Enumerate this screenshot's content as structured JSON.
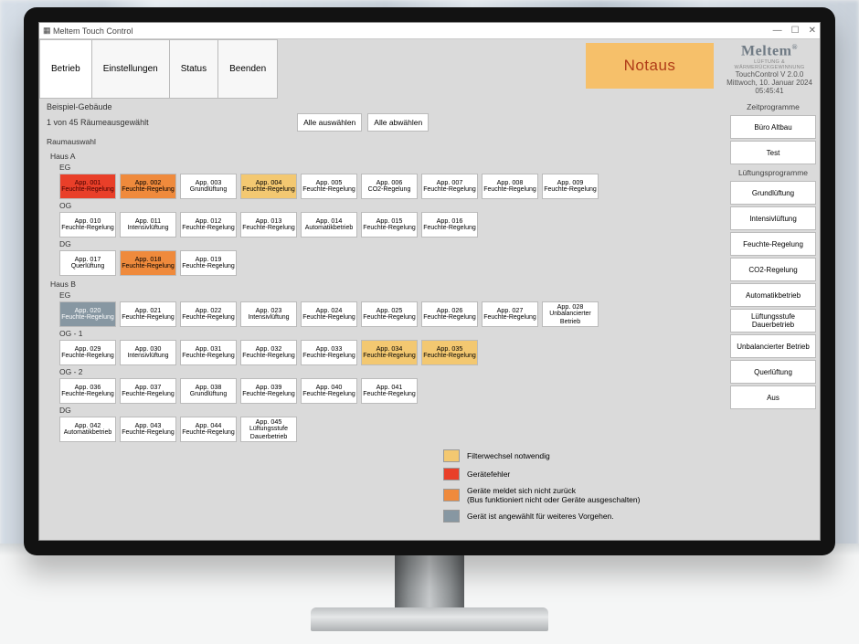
{
  "window": {
    "title": "Meltem Touch Control"
  },
  "menu": {
    "items": [
      "Betrieb",
      "Einstellungen",
      "Status",
      "Beenden"
    ],
    "active": 0
  },
  "brand": {
    "name": "Meltem",
    "sub": "LÜFTUNG & WÄRMERÜCKGEWINNUNG",
    "product": "TouchControl V 2.0.0",
    "datetime": "Mittwoch, 10. Januar 2024 05:45:41"
  },
  "notaus": "Notaus",
  "header": {
    "building": "Beispiel-Gebäude",
    "selection": "1 von 45 Räumeausgewählt",
    "select_all": "Alle auswählen",
    "deselect_all": "Alle abwählen",
    "roomselect": "Raumauswahl"
  },
  "sidebar": {
    "zp_header": "Zeitprogramme",
    "zp_items": [
      "Büro Altbau",
      "Test"
    ],
    "lp_header": "Lüftungsprogramme",
    "lp_items": [
      "Grundlüftung",
      "Intensivlüftung",
      "Feuchte-Regelung",
      "CO2-Regelung",
      "Automatikbetrieb",
      "Lüftungsstufe Dauerbetrieb",
      "Unbalancierter Betrieb",
      "Querlüftung",
      "Aus"
    ]
  },
  "legend": {
    "filter": "Filterwechsel notwendig",
    "error": "Gerätefehler",
    "offline": "Geräte meldet sich nicht zurück\n(Bus funktioniert nicht oder Geräte ausgeschalten)",
    "selected": "Gerät ist angewählt für weiteres Vorgehen."
  },
  "houses": [
    {
      "name": "Haus A",
      "floors": [
        {
          "name": "EG",
          "rooms": [
            {
              "id": "App. 001",
              "mode": "Feuchte-Regelung",
              "status": "error"
            },
            {
              "id": "App. 002",
              "mode": "Feuchte-Regelung",
              "status": "offline"
            },
            {
              "id": "App. 003",
              "mode": "Grundlüftung",
              "status": "ok"
            },
            {
              "id": "App. 004",
              "mode": "Feuchte-Regelung",
              "status": "filter"
            },
            {
              "id": "App. 005",
              "mode": "Feuchte-Regelung",
              "status": "ok"
            },
            {
              "id": "App. 006",
              "mode": "CO2-Regelung",
              "status": "ok"
            },
            {
              "id": "App. 007",
              "mode": "Feuchte-Regelung",
              "status": "ok"
            },
            {
              "id": "App. 008",
              "mode": "Feuchte-Regelung",
              "status": "ok"
            },
            {
              "id": "App. 009",
              "mode": "Feuchte-Regelung",
              "status": "ok"
            }
          ]
        },
        {
          "name": "OG",
          "rooms": [
            {
              "id": "App. 010",
              "mode": "Feuchte-Regelung",
              "status": "ok"
            },
            {
              "id": "App. 011",
              "mode": "Intensivlüftung",
              "status": "ok"
            },
            {
              "id": "App. 012",
              "mode": "Feuchte-Regelung",
              "status": "ok"
            },
            {
              "id": "App. 013",
              "mode": "Feuchte-Regelung",
              "status": "ok"
            },
            {
              "id": "App. 014",
              "mode": "Automatikbetrieb",
              "status": "ok"
            },
            {
              "id": "App. 015",
              "mode": "Feuchte-Regelung",
              "status": "ok"
            },
            {
              "id": "App. 016",
              "mode": "Feuchte-Regelung",
              "status": "ok"
            }
          ]
        },
        {
          "name": "DG",
          "rooms": [
            {
              "id": "App. 017",
              "mode": "Querlüftung",
              "status": "ok"
            },
            {
              "id": "App. 018",
              "mode": "Feuchte-Regelung",
              "status": "offline"
            },
            {
              "id": "App. 019",
              "mode": "Feuchte-Regelung",
              "status": "ok"
            }
          ]
        }
      ]
    },
    {
      "name": "Haus B",
      "floors": [
        {
          "name": "EG",
          "rooms": [
            {
              "id": "App. 020",
              "mode": "Feuchte-Regelung",
              "status": "selected"
            },
            {
              "id": "App. 021",
              "mode": "Feuchte-Regelung",
              "status": "ok"
            },
            {
              "id": "App. 022",
              "mode": "Feuchte-Regelung",
              "status": "ok"
            },
            {
              "id": "App. 023",
              "mode": "Intensivlüftung",
              "status": "ok"
            },
            {
              "id": "App. 024",
              "mode": "Feuchte-Regelung",
              "status": "ok"
            },
            {
              "id": "App. 025",
              "mode": "Feuchte-Regelung",
              "status": "ok"
            },
            {
              "id": "App. 026",
              "mode": "Feuchte-Regelung",
              "status": "ok"
            },
            {
              "id": "App. 027",
              "mode": "Feuchte-Regelung",
              "status": "ok"
            },
            {
              "id": "App. 028",
              "mode": "Unbalancierter Betrieb",
              "status": "ok"
            }
          ]
        },
        {
          "name": "OG - 1",
          "rooms": [
            {
              "id": "App. 029",
              "mode": "Feuchte-Regelung",
              "status": "ok"
            },
            {
              "id": "App. 030",
              "mode": "Intensivlüftung",
              "status": "ok"
            },
            {
              "id": "App. 031",
              "mode": "Feuchte-Regelung",
              "status": "ok"
            },
            {
              "id": "App. 032",
              "mode": "Feuchte-Regelung",
              "status": "ok"
            },
            {
              "id": "App. 033",
              "mode": "Feuchte-Regelung",
              "status": "ok"
            },
            {
              "id": "App. 034",
              "mode": "Feuchte-Regelung",
              "status": "filter"
            },
            {
              "id": "App. 035",
              "mode": "Feuchte-Regelung",
              "status": "filter"
            }
          ]
        },
        {
          "name": "OG - 2",
          "rooms": [
            {
              "id": "App. 036",
              "mode": "Feuchte-Regelung",
              "status": "ok"
            },
            {
              "id": "App. 037",
              "mode": "Feuchte-Regelung",
              "status": "ok"
            },
            {
              "id": "App. 038",
              "mode": "Grundlüftung",
              "status": "ok"
            },
            {
              "id": "App. 039",
              "mode": "Feuchte-Regelung",
              "status": "ok"
            },
            {
              "id": "App. 040",
              "mode": "Feuchte-Regelung",
              "status": "ok"
            },
            {
              "id": "App. 041",
              "mode": "Feuchte-Regelung",
              "status": "ok"
            }
          ]
        },
        {
          "name": "DG",
          "rooms": [
            {
              "id": "App. 042",
              "mode": "Automatikbetrieb",
              "status": "ok"
            },
            {
              "id": "App. 043",
              "mode": "Feuchte-Regelung",
              "status": "ok"
            },
            {
              "id": "App. 044",
              "mode": "Feuchte-Regelung",
              "status": "ok"
            },
            {
              "id": "App. 045",
              "mode": "Lüftungsstufe Dauerbetrieb",
              "status": "ok"
            }
          ]
        }
      ]
    }
  ]
}
